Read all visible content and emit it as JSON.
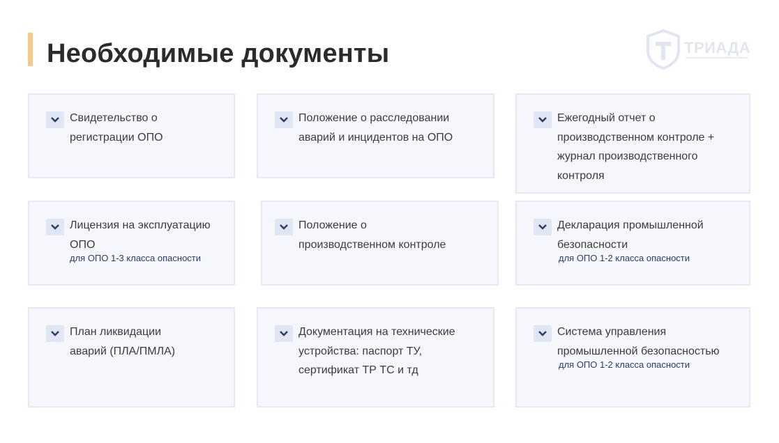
{
  "header": {
    "title": "Необходимые документы"
  },
  "logo": {
    "text": "ТРИАДА"
  },
  "cards": [
    {
      "title": "Свидетельство о регистрации ОПО",
      "note": ""
    },
    {
      "title": "Положение о расследовании аварий и инцидентов на ОПО",
      "note": ""
    },
    {
      "title": "Ежегодный отчет о производственном контроле + журнал производственного контроля",
      "note": ""
    },
    {
      "title": "Лицензия на эксплуатацию ОПО",
      "note": "для ОПО 1-3 класса опасности"
    },
    {
      "title": "Положение о производственном контроле",
      "note": ""
    },
    {
      "title": "Декларация промышленной безопасности",
      "note": "для ОПО 1-2 класса опасности"
    },
    {
      "title": "План ликвидации аварий (ПЛА/ПМЛА)",
      "note": ""
    },
    {
      "title": "Документация на технические устройства: паспорт ТУ, сертификат ТР ТС и тд",
      "note": ""
    },
    {
      "title": "Система управления промышленной безопасностью",
      "note": "для ОПО 1-2 класса опасности"
    }
  ],
  "colors": {
    "accent": "#f2c98a",
    "card_background": "#f6f7fc",
    "card_border": "#e6e9f5",
    "chevron": "#2c3a66",
    "note_text": "#2c3a66"
  },
  "icons": {
    "chevron": "chevron-down-icon",
    "logo": "shield-logo-icon"
  }
}
